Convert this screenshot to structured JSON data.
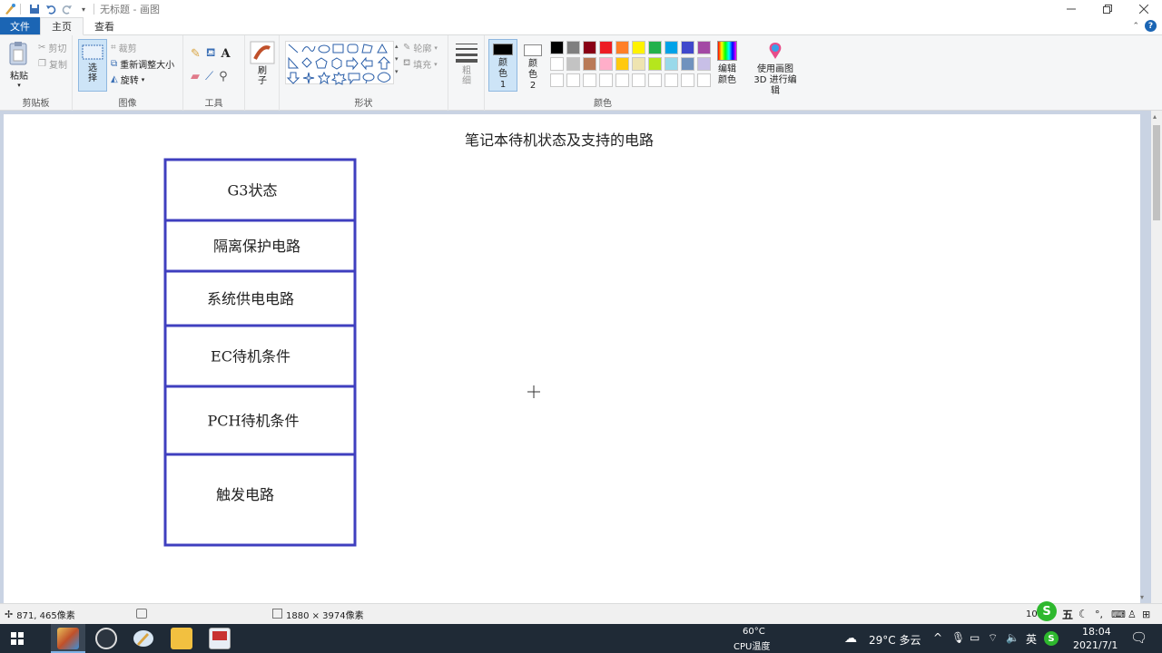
{
  "app": {
    "title": "无标题 - 画图"
  },
  "tabs": {
    "file": "文件",
    "home": "主页",
    "view": "查看"
  },
  "ribbon": {
    "clipboard": {
      "paste": "粘贴",
      "cut": "剪切",
      "copy": "复制",
      "label": "剪贴板"
    },
    "image": {
      "select": "选择",
      "crop": "裁剪",
      "resize": "重新调整大小",
      "rotate": "旋转",
      "label": "图像"
    },
    "tools": {
      "label": "工具"
    },
    "brushes": {
      "label": "刷子"
    },
    "shapes": {
      "outline": "轮廓",
      "fill": "填充",
      "label": "形状"
    },
    "size": {
      "label": "粗细"
    },
    "colors": {
      "color1": "颜色 1",
      "color2": "颜色 2",
      "edit": "编辑颜色",
      "paint3d": "使用画图 3D 进行编辑",
      "label": "颜色",
      "color1_value": "#000000",
      "color2_value": "#ffffff",
      "palette_row1": [
        "#000000",
        "#7f7f7f",
        "#880015",
        "#ed1c24",
        "#ff7f27",
        "#fff200",
        "#22b14c",
        "#00a2e8",
        "#3f48cc",
        "#a349a4"
      ],
      "palette_row2": [
        "#ffffff",
        "#c3c3c3",
        "#b97a57",
        "#ffaec9",
        "#ffc90e",
        "#efe4b0",
        "#b5e61d",
        "#99d9ea",
        "#7092be",
        "#c8bfe7"
      ]
    }
  },
  "canvas": {
    "heading": "笔记本待机状态及支持的电路",
    "boxes": [
      "G3状态",
      "隔离保护电路",
      "系统供电电路",
      "EC待机条件",
      "PCH待机条件",
      "触发电路"
    ],
    "border_color": "#3f3fbf"
  },
  "status": {
    "cursor": "871, 465像素",
    "size": "1880 × 3974像素",
    "zoom": "10"
  },
  "taskbar": {
    "temp": "60°C",
    "temp_label": "CPU温度",
    "weather": "29°C 多云",
    "ime": "英",
    "time": "18:04",
    "date": "2021/7/1",
    "ime_bar": "五"
  }
}
